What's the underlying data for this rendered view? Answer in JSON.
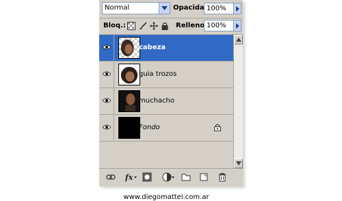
{
  "blend_mode": "Normal",
  "opacity": {
    "label": "Opacidad:",
    "value": "100%"
  },
  "lock": {
    "label": "Bloq.:"
  },
  "fill": {
    "label": "Relleno:",
    "value": "100%"
  },
  "layers": [
    {
      "name": "cabeza",
      "selected": true
    },
    {
      "name": "guia trozos",
      "selected": false
    },
    {
      "name": "muchacho",
      "selected": false
    },
    {
      "name": "Fondo",
      "selected": false,
      "locked": true
    }
  ],
  "watermark": "www.diegomattei.com.ar",
  "colors": {
    "selection": "#316ac5",
    "panel": "#d4d0c8"
  }
}
